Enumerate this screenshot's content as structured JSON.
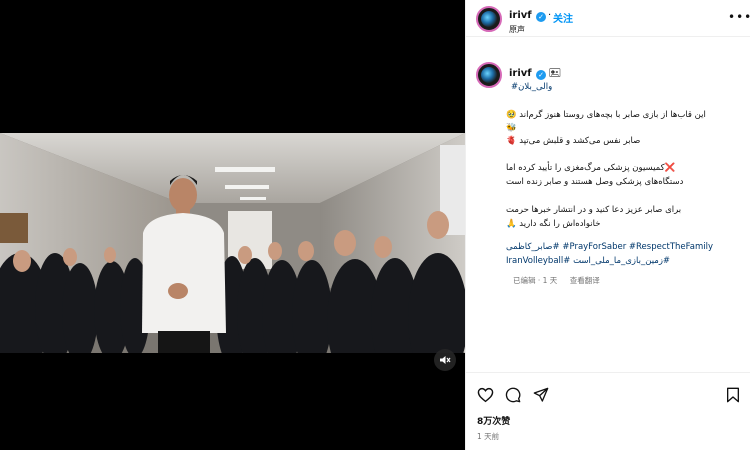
{
  "header": {
    "username": "irivf",
    "follow_label": "关注",
    "subtitle": "原声"
  },
  "post": {
    "username": "irivf",
    "hashtag": "#والی_بلان",
    "caption_lines": [
      "این قاب‌ها از بازی صابر با بچه‌های روستا هنوز گرم‌اند 🥹",
      "🐝",
      "صابر نفس می‌کشد و قلبش می‌تپد 🫀"
    ],
    "caption_lines_2": [
      "❌کمیسیون پزشکی مرگ‌مغزی را تأیید کرده اما",
      "دستگاه‌های پزشکی وصل هستند و صابر زنده است"
    ],
    "caption_lines_3": [
      "برای صابر عزیز دعا کنید و در انتشار خبرها حرمت",
      "خانواده‌اش را نگه دارید 🙏"
    ],
    "tags_line_1": "PrayForSaber #RespectTheFamily# #صابر_کاظمی",
    "tags_line_2": "#زمین_بازی_ما_ملی_است #IranVolleyball",
    "meta_time": "已编辑 · 1 天",
    "meta_translate": "查看翻译"
  },
  "footer": {
    "likes": "8万次赞",
    "time": "1 天前"
  },
  "icons": {
    "like": "heart-icon",
    "comment": "comment-icon",
    "share": "send-icon",
    "save": "bookmark-icon",
    "mute": "muted-speaker-icon",
    "more": "more-dots-icon"
  },
  "colors": {
    "link": "#00376b",
    "follow": "#0095f6",
    "verified": "#1d9bf0"
  }
}
